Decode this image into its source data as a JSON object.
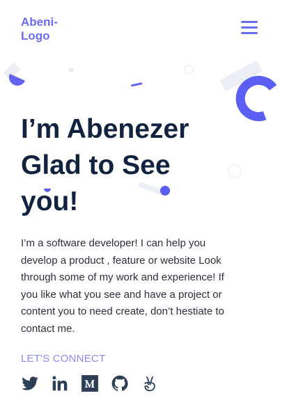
{
  "header": {
    "logo_text": "Abeni-Logo",
    "menu_icon": "hamburger-menu-icon"
  },
  "hero": {
    "headline_line1": "I’m Abenezer",
    "headline_line2": "Glad to See",
    "headline_line3": "you!",
    "bio": "I’m a software developer! I can help you develop a product , feature or website Look through some of my work and experience! If you like what you see and have a project or content you to need create, don’t hestiate to contact me."
  },
  "connect": {
    "label": "LET'S CONNECT",
    "socials": [
      {
        "icon": "twitter-icon"
      },
      {
        "icon": "linkedin-icon"
      },
      {
        "icon": "medium-icon"
      },
      {
        "icon": "github-icon"
      },
      {
        "icon": "angellist-icon"
      }
    ]
  },
  "colors": {
    "accent": "#6a6cf0",
    "heading": "#12233f",
    "text": "#2b2f3a",
    "icon": "#2d3f57"
  }
}
